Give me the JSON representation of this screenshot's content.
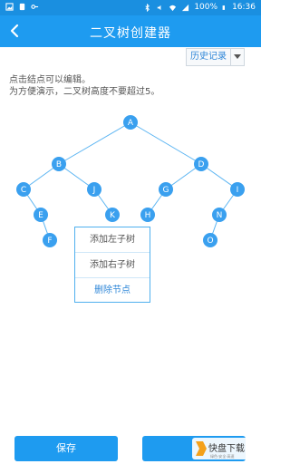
{
  "status_bar": {
    "battery": "100%",
    "time": "16:36"
  },
  "app_bar": {
    "title": "二叉树创建器",
    "back_icon": "chevron-left-icon"
  },
  "history": {
    "label": "历史记录",
    "dropdown_icon": "caret-down-icon"
  },
  "instructions": {
    "line1": "点击结点可以编辑。",
    "line2": "为方便演示，二叉树高度不要超过5。"
  },
  "tree": {
    "node_color": "#3aa0ef",
    "edge_color": "#5ab4f2",
    "nodes": [
      {
        "label": "A"
      },
      {
        "label": "B"
      },
      {
        "label": "D"
      },
      {
        "label": "C"
      },
      {
        "label": "J"
      },
      {
        "label": "G"
      },
      {
        "label": "I"
      },
      {
        "label": "E"
      },
      {
        "label": "K"
      },
      {
        "label": "H"
      },
      {
        "label": "N"
      },
      {
        "label": "F"
      },
      {
        "label": "O"
      }
    ]
  },
  "context_menu": {
    "items": [
      {
        "label": "添加左子树"
      },
      {
        "label": "添加右子树"
      },
      {
        "label": "删除节点"
      }
    ]
  },
  "buttons": {
    "save": "保存",
    "second": ""
  },
  "watermark": {
    "text": "快盘下载",
    "subtext": "绿色·安全·高速"
  },
  "colors": {
    "primary": "#1e9bf0",
    "status_bar": "#1a8fe0"
  }
}
